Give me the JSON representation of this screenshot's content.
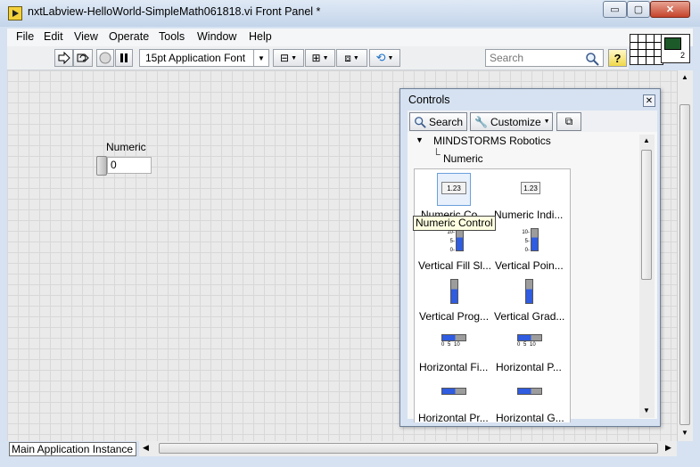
{
  "window": {
    "title": "nxtLabview-HelloWorld-SimpleMath061818.vi Front Panel *",
    "minimize_glyph": "▭",
    "maximize_glyph": "▢",
    "close_glyph": "✕"
  },
  "menubar": {
    "items": [
      "File",
      "Edit",
      "View",
      "Operate",
      "Tools",
      "Window",
      "Help"
    ]
  },
  "toolbar": {
    "run_icon": "run-arrow-icon",
    "run_continuous_icon": "run-continuously-icon",
    "abort_icon": "abort-icon",
    "pause_icon": "pause-icon",
    "font_select_value": "15pt Application Font",
    "align_icon": "align-objects-icon",
    "distribute_icon": "distribute-objects-icon",
    "resize_icon": "resize-objects-icon",
    "reorder_icon": "reorder-icon",
    "search_placeholder": "Search",
    "help_label": "?",
    "connector_pane_number": "2"
  },
  "front_panel": {
    "numeric_label": "Numeric",
    "numeric_value": "0",
    "status_label": "Main Application Instance"
  },
  "controls_palette": {
    "title": "Controls",
    "close_glyph": "✕",
    "search_label": "Search",
    "customize_label": "Customize",
    "tree_category": "MINDSTORMS Robotics",
    "tree_subcategory": "Numeric",
    "items": [
      {
        "label": "Numeric Co...",
        "glyph": "1.23"
      },
      {
        "label": "Numeric Indi...",
        "glyph": "1.23"
      },
      {
        "label": "Vertical Fill Sl..."
      },
      {
        "label": "Vertical Poin..."
      },
      {
        "label": "Vertical Prog..."
      },
      {
        "label": "Vertical Grad..."
      },
      {
        "label": "Horizontal Fi..."
      },
      {
        "label": "Horizontal P..."
      },
      {
        "label": "Horizontal Pr..."
      },
      {
        "label": "Horizontal G..."
      }
    ],
    "tooltip": "Numeric Control",
    "scale_ticks_vertical": [
      "10-",
      "5-",
      "0-"
    ],
    "scale_ticks_horizontal": "0 5 10"
  },
  "colors": {
    "accent_fill": "#2f5ce0",
    "titlebar": "#c4d5ea",
    "grid_background": "#eaeaea"
  }
}
